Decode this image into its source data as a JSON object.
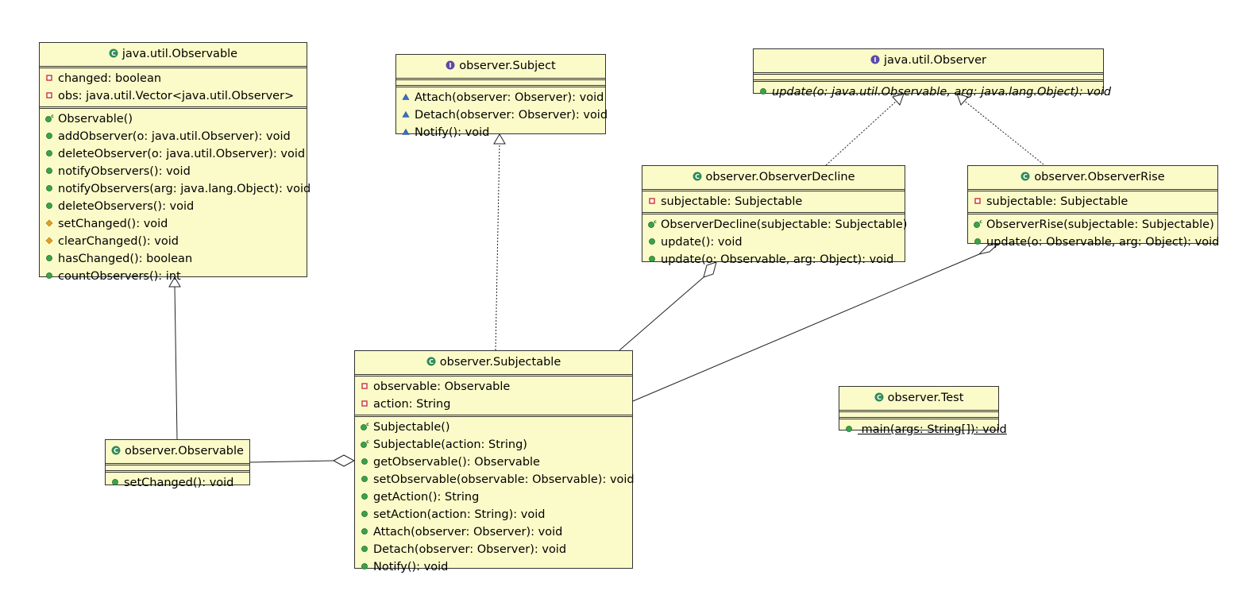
{
  "colors": {
    "box_fill": "#fbfbc9",
    "class_icon": "#2e8b57",
    "interface_icon": "#5b4aa8",
    "public": "#3aa34a",
    "private": "#cc3333",
    "protected": "#e0a020"
  },
  "classes": {
    "java_observable": {
      "title": "java.util.Observable",
      "kind": "class",
      "attributes": [
        {
          "vis": "private",
          "text": "changed: boolean"
        },
        {
          "vis": "private",
          "text": "obs: java.util.Vector<java.util.Observer>"
        }
      ],
      "methods": [
        {
          "vis": "constructor",
          "text": "Observable()"
        },
        {
          "vis": "public",
          "text": "addObserver(o: java.util.Observer): void"
        },
        {
          "vis": "public",
          "text": "deleteObserver(o: java.util.Observer): void"
        },
        {
          "vis": "public",
          "text": "notifyObservers(): void"
        },
        {
          "vis": "public",
          "text": "notifyObservers(arg: java.lang.Object): void"
        },
        {
          "vis": "public",
          "text": "deleteObservers(): void"
        },
        {
          "vis": "protected",
          "text": "setChanged(): void"
        },
        {
          "vis": "protected",
          "text": "clearChanged(): void"
        },
        {
          "vis": "public",
          "text": "hasChanged(): boolean"
        },
        {
          "vis": "public",
          "text": "countObservers(): int"
        }
      ]
    },
    "subject": {
      "title": "observer.Subject",
      "kind": "interface",
      "attributes": [],
      "methods": [
        {
          "vis": "package",
          "text": "Attach(observer: Observer): void"
        },
        {
          "vis": "package",
          "text": "Detach(observer: Observer): void"
        },
        {
          "vis": "package",
          "text": "Notify(): void"
        }
      ]
    },
    "java_observer": {
      "title": "java.util.Observer",
      "kind": "interface",
      "attributes": [],
      "methods": [
        {
          "vis": "public",
          "text": "update(o: java.util.Observable, arg: java.lang.Object): void",
          "italic": true
        }
      ]
    },
    "observer_decline": {
      "title": "observer.ObserverDecline",
      "kind": "class",
      "attributes": [
        {
          "vis": "private",
          "text": "subjectable: Subjectable"
        }
      ],
      "methods": [
        {
          "vis": "constructor",
          "text": "ObserverDecline(subjectable: Subjectable)"
        },
        {
          "vis": "public",
          "text": "update(): void"
        },
        {
          "vis": "public",
          "text": "update(o: Observable, arg: Object): void"
        }
      ]
    },
    "observer_rise": {
      "title": "observer.ObserverRise",
      "kind": "class",
      "attributes": [
        {
          "vis": "private",
          "text": "subjectable: Subjectable"
        }
      ],
      "methods": [
        {
          "vis": "constructor",
          "text": "ObserverRise(subjectable: Subjectable)"
        },
        {
          "vis": "public",
          "text": "update(o: Observable, arg: Object): void"
        }
      ]
    },
    "subjectable": {
      "title": "observer.Subjectable",
      "kind": "class",
      "attributes": [
        {
          "vis": "private",
          "text": "observable: Observable"
        },
        {
          "vis": "private",
          "text": "action: String"
        }
      ],
      "methods": [
        {
          "vis": "constructor",
          "text": "Subjectable()"
        },
        {
          "vis": "constructor",
          "text": "Subjectable(action: String)"
        },
        {
          "vis": "public",
          "text": "getObservable(): Observable"
        },
        {
          "vis": "public",
          "text": "setObservable(observable: Observable): void"
        },
        {
          "vis": "public",
          "text": "getAction(): String"
        },
        {
          "vis": "public",
          "text": "setAction(action: String): void"
        },
        {
          "vis": "public",
          "text": "Attach(observer: Observer): void"
        },
        {
          "vis": "public",
          "text": "Detach(observer: Observer): void"
        },
        {
          "vis": "public",
          "text": "Notify(): void"
        }
      ]
    },
    "observer_observable": {
      "title": "observer.Observable",
      "kind": "class",
      "attributes": [],
      "methods": [
        {
          "vis": "public",
          "text": "setChanged(): void"
        }
      ]
    },
    "observer_test": {
      "title": "observer.Test",
      "kind": "class",
      "attributes": [],
      "methods": [
        {
          "vis": "public",
          "text": " main(args: String[]): void",
          "underline": true
        }
      ]
    }
  },
  "relations": [
    {
      "from": "observer_observable",
      "to": "java_observable",
      "type": "generalization"
    },
    {
      "from": "subjectable",
      "to": "subject",
      "type": "realization"
    },
    {
      "from": "observer_decline",
      "to": "java_observer",
      "type": "realization"
    },
    {
      "from": "observer_rise",
      "to": "java_observer",
      "type": "realization"
    },
    {
      "from": "subjectable",
      "to": "observer_decline",
      "type": "aggregation"
    },
    {
      "from": "subjectable",
      "to": "observer_rise",
      "type": "aggregation"
    },
    {
      "from": "observer_observable",
      "to": "subjectable",
      "type": "aggregation"
    }
  ]
}
